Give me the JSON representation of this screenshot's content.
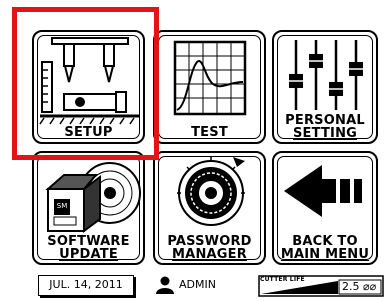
{
  "tiles": {
    "setup": {
      "label": "SETUP"
    },
    "test": {
      "label": "TEST"
    },
    "personal_setting": {
      "line1": "PERSONAL",
      "line2": "SETTING"
    },
    "software_update": {
      "line1": "SOFTWARE",
      "line2": "UPDATE"
    },
    "password_manager": {
      "line1": "PASSWORD",
      "line2": "MANAGER"
    },
    "back_to_main_menu": {
      "line1": "BACK TO",
      "line2": "MAIN MENU"
    }
  },
  "icons": {
    "setup": "grip-fixture-icon",
    "test": "graph-icon",
    "personal_setting": "sliders-icon",
    "software_update": "box-disc-icon",
    "password_manager": "knob-dial-icon",
    "back": "arrow-left-icon"
  },
  "status": {
    "date": "JUL. 14, 2011",
    "user": "ADMIN",
    "cutter_label": "CUTTER LIFE",
    "cutter_value": "2.5 ⌀⌀"
  },
  "highlight_color": "#e2131b"
}
